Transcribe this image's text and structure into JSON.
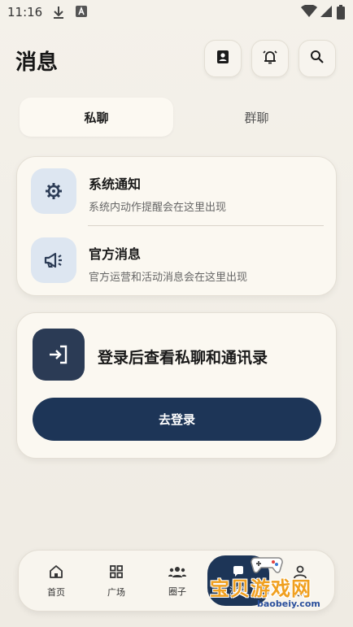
{
  "status_bar": {
    "time": "11:16"
  },
  "header": {
    "title": "消息"
  },
  "tabs": [
    {
      "label": "私聊",
      "active": true
    },
    {
      "label": "群聊",
      "active": false
    }
  ],
  "notifications": [
    {
      "title": "系统通知",
      "subtitle": "系统内动作提醒会在这里出现",
      "icon": "gear-icon"
    },
    {
      "title": "官方消息",
      "subtitle": "官方运营和活动消息会在这里出现",
      "icon": "megaphone-icon"
    }
  ],
  "login": {
    "prompt": "登录后查看私聊和通讯录",
    "button_label": "去登录"
  },
  "bottom_nav": [
    {
      "label": "首页",
      "icon": "home-icon"
    },
    {
      "label": "广场",
      "icon": "grid-icon"
    },
    {
      "label": "圈子",
      "icon": "group-icon"
    },
    {
      "label": "消息",
      "icon": "message-icon",
      "active": true
    },
    {
      "label": "我的",
      "icon": "user-icon"
    }
  ],
  "watermark": {
    "text": "宝贝游戏网",
    "url": "baobeiy.com"
  },
  "colors": {
    "accent": "#1d3557",
    "background": "#f4f1ea",
    "icon_bg": "#dde6f1"
  }
}
